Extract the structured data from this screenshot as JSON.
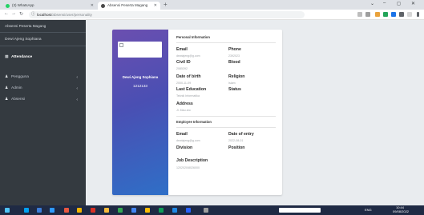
{
  "browser": {
    "tabs": [
      {
        "title": "(3) WhatsApp",
        "favicon_color": "#25d366"
      },
      {
        "title": "Absensi Peserta Magang",
        "favicon_color": "#4a4a4a"
      }
    ],
    "new_tab_symbol": "+",
    "url_host": "localhost",
    "url_path": "/absensi/user/personality",
    "window_controls": [
      "⌄",
      "–",
      "◻",
      "✕"
    ]
  },
  "sidebar": {
    "brand": "Absensi Peserta Magang",
    "user_name": "Dewi Ajeng Sophiana",
    "items": [
      {
        "label": "Attendance",
        "icon": "calendar-icon",
        "has_arrow": false
      },
      {
        "label": "Pengguna",
        "icon": "users-icon",
        "has_arrow": true
      },
      {
        "label": "Admin",
        "icon": "users-icon",
        "has_arrow": true
      },
      {
        "label": "Absensi",
        "icon": "users-icon",
        "has_arrow": true
      }
    ]
  },
  "profile": {
    "name": "Dewi Ajeng Sophiana",
    "id_number": "1212133"
  },
  "personal": {
    "section_title": "Personal Information",
    "email_label": "Email",
    "email_value": "dewiajeng@g.com",
    "phone_label": "Phone",
    "phone_value": "2392023",
    "civil_id_label": "Civil ID",
    "civil_id_value": "2085392",
    "blood_label": "Blood",
    "blood_value": "",
    "dob_label": "Date of birth",
    "dob_value": "2000-11-09",
    "religion_label": "Religion",
    "religion_value": "Islam",
    "education_label": "Last Education",
    "education_value": "Teknik Informatika",
    "status_label": "Status",
    "status_value": "",
    "address_label": "Address",
    "address_value": "Jl. Mau aro"
  },
  "employee": {
    "section_title": "Employee Information",
    "email_label": "Email",
    "email_value": "dewiajeng@g.com",
    "entry_label": "Date of entry",
    "entry_value": "2022-08-01",
    "division_label": "Division",
    "division_value": "",
    "position_label": "Position",
    "position_value": "",
    "job_label": "Job Description",
    "job_value": "1202020/8026000"
  },
  "taskbar": {
    "time": "10:44",
    "date": "09/08/2022",
    "lang": "ENG"
  }
}
